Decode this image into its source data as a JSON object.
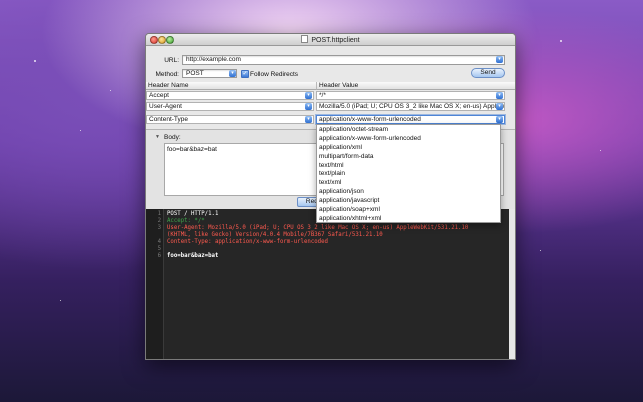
{
  "window": {
    "title": "POST.httpclient"
  },
  "request": {
    "url_label": "URL:",
    "url_value": "http://example.com",
    "method_label": "Method:",
    "method_value": "POST",
    "follow_redirects_label": "Follow Redirects",
    "follow_redirects_checked": true,
    "send_label": "Send"
  },
  "headers": {
    "col_name": "Header Name",
    "col_value": "Header Value",
    "rows": [
      {
        "name": "Accept",
        "value": "*/*"
      },
      {
        "name": "User-Agent",
        "value": "Mozilla/5.0 (iPad; U; CPU OS 3_2 like Mac OS X; en-us) AppleWebK"
      },
      {
        "name": "Content-Type",
        "value": "application/x-www-form-urlencoded"
      }
    ]
  },
  "dropdown": {
    "options": [
      "application/octet-stream",
      "application/x-www-form-urlencoded",
      "application/xml",
      "multipart/form-data",
      "text/html",
      "text/plain",
      "text/xml",
      "application/json",
      "application/javascript",
      "application/soap+xml",
      "application/xhtml+xml"
    ]
  },
  "body": {
    "label": "Body:",
    "content": "foo=bar&baz=bat",
    "request_button_label": "Request"
  },
  "console": {
    "lines": [
      {
        "n": "1",
        "text": "POST / HTTP/1.1"
      },
      {
        "n": "2",
        "text": "Accept: */*"
      },
      {
        "n": "3",
        "text": "User-Agent: Mozilla/5.0 (iPad; U; CPU OS 3_2 like Mac OS X; en-us) AppleWebKit/531.21.10"
      },
      {
        "n": "",
        "text": "(KHTML, like Gecko) Version/4.0.4 Mobile/7B367 Safari/531.21.10"
      },
      {
        "n": "4",
        "text": "Content-Type: application/x-www-form-urlencoded"
      },
      {
        "n": "5",
        "text": ""
      },
      {
        "n": "6",
        "text": "foo=bar&baz=bat"
      }
    ]
  },
  "colors": {
    "header_text": "#ff5a4f",
    "header_key": "#3fa24a",
    "body_text": "#ffffff",
    "selection": "#3a78d8"
  }
}
